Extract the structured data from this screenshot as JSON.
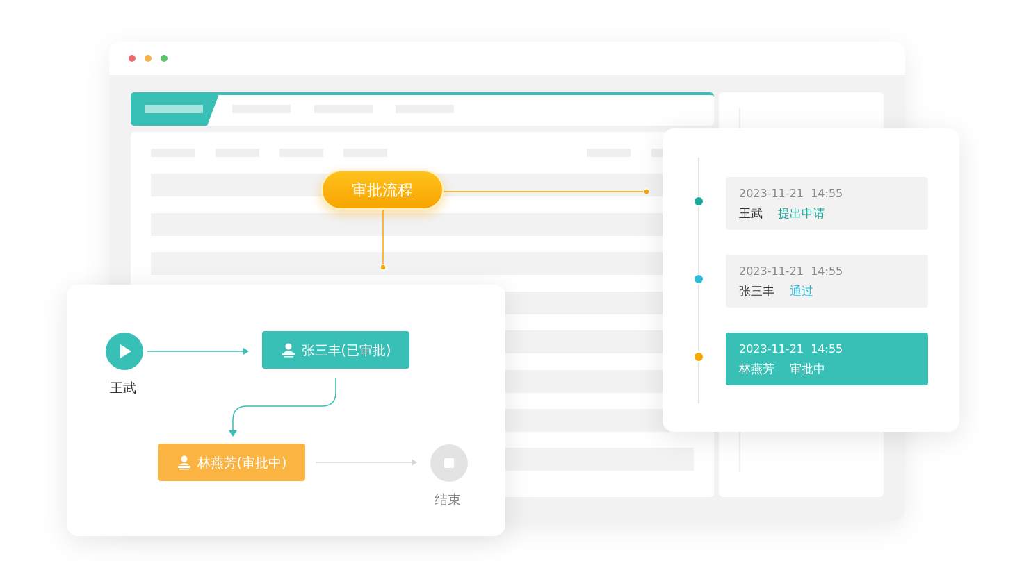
{
  "window": {
    "controls": [
      {
        "color": "#ef6b6b"
      },
      {
        "color": "#f5b24f"
      },
      {
        "color": "#5cc46a"
      }
    ]
  },
  "flow_badge": {
    "label": "审批流程"
  },
  "flow": {
    "start": {
      "label": "王武"
    },
    "nodes": [
      {
        "label": "张三丰(已审批)",
        "kind": "approved"
      },
      {
        "label": "林燕芳(审批中)",
        "kind": "pending"
      }
    ],
    "end": {
      "label": "结束"
    }
  },
  "timeline": [
    {
      "time": "2023-11-21  14:55",
      "name": "王武",
      "action": "提出申请",
      "color": "#19a99b",
      "selected": false
    },
    {
      "time": "2023-11-21  14:55",
      "name": "张三丰",
      "action": "通过",
      "color": "#2bbbd8",
      "selected": false
    },
    {
      "time": "2023-11-21  14:55",
      "name": "林燕芳",
      "action": "审批中",
      "color": "#f5a800",
      "selected": true
    }
  ]
}
